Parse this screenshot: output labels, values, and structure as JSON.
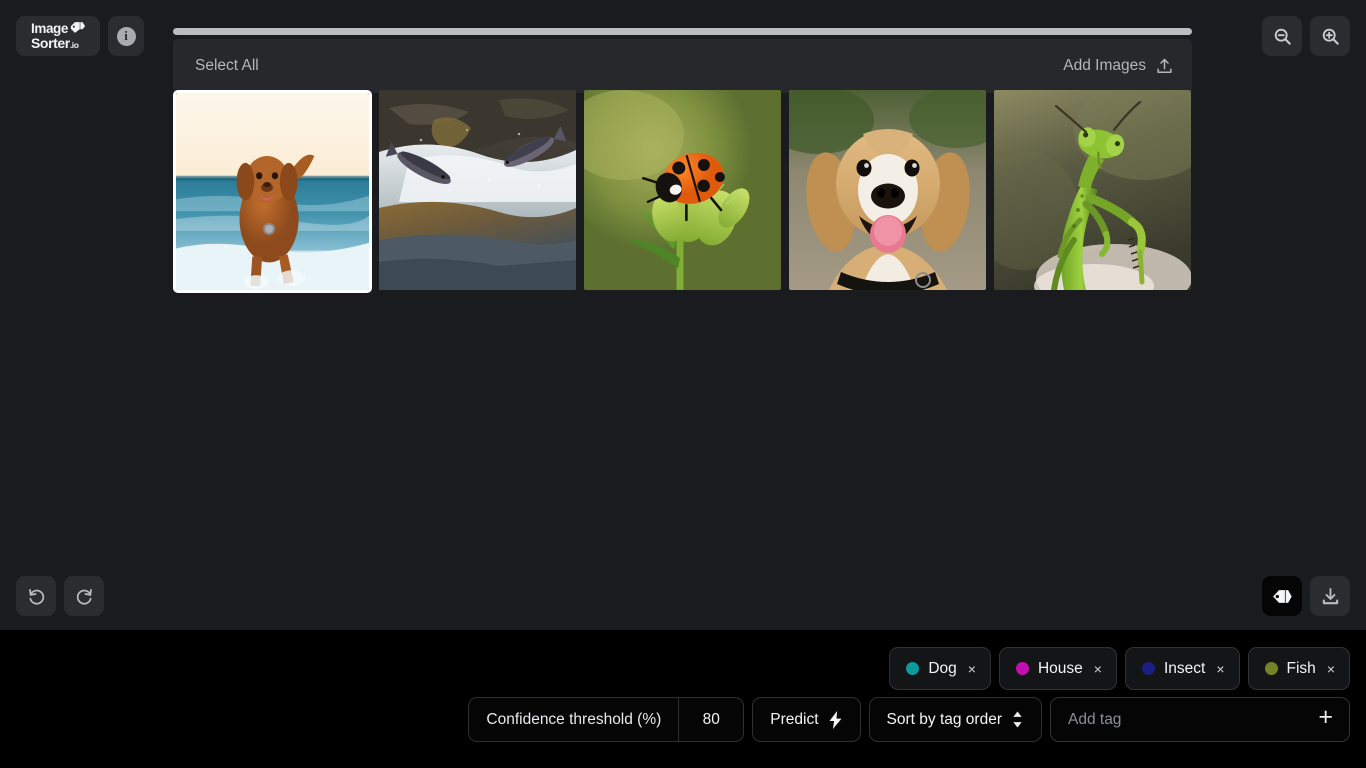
{
  "app": {
    "logo_line1": "Image",
    "logo_line2": "Sorter",
    "logo_suffix": ".io",
    "info_label": "i"
  },
  "toolbar_top": {
    "zoom_out_label": "Zoom out",
    "zoom_in_label": "Zoom in"
  },
  "gallery": {
    "select_all_label": "Select All",
    "add_images_label": "Add Images",
    "images": [
      {
        "name": "dog-running-on-beach",
        "alt": "Brown retriever running through surf at sunset",
        "selected": true
      },
      {
        "name": "salmon-jumping-rapids",
        "alt": "Salmon leaping up a whitewater rapid over rocks",
        "selected": false
      },
      {
        "name": "ladybug-on-plant",
        "alt": "Red ladybug with black spots on a green flower bud",
        "selected": false
      },
      {
        "name": "beagle-portrait",
        "alt": "Smiling beagle dog with tongue out wearing black collar",
        "selected": false
      },
      {
        "name": "praying-mantis",
        "alt": "Green praying mantis close-up",
        "selected": false
      }
    ]
  },
  "history": {
    "undo_label": "Undo",
    "redo_label": "Redo"
  },
  "tools": {
    "tags_label": "Tags",
    "export_label": "Export"
  },
  "tags": [
    {
      "label": "Dog",
      "color": "#0d9a9a",
      "remove_label": "×"
    },
    {
      "label": "House",
      "color": "#c40fb0",
      "remove_label": "×"
    },
    {
      "label": "Insect",
      "color": "#1c1f82",
      "remove_label": "×"
    },
    {
      "label": "Fish",
      "color": "#76812a",
      "remove_label": "×"
    }
  ],
  "controls": {
    "confidence_label": "Confidence threshold (%)",
    "confidence_value": "80",
    "predict_label": "Predict",
    "sort_label": "Sort by tag order",
    "add_tag_placeholder": "Add tag",
    "add_tag_value": "",
    "add_button_label": "+"
  },
  "theme": {
    "background": "#1a1b1e",
    "panel": "#27282b",
    "bottom_panel": "#000000",
    "button": "#2b2c2f",
    "text_muted": "#b3b6bb",
    "text": "#f3f4f6",
    "scrollbar": "#b9bcc2",
    "selection_border": "#ffffff"
  }
}
